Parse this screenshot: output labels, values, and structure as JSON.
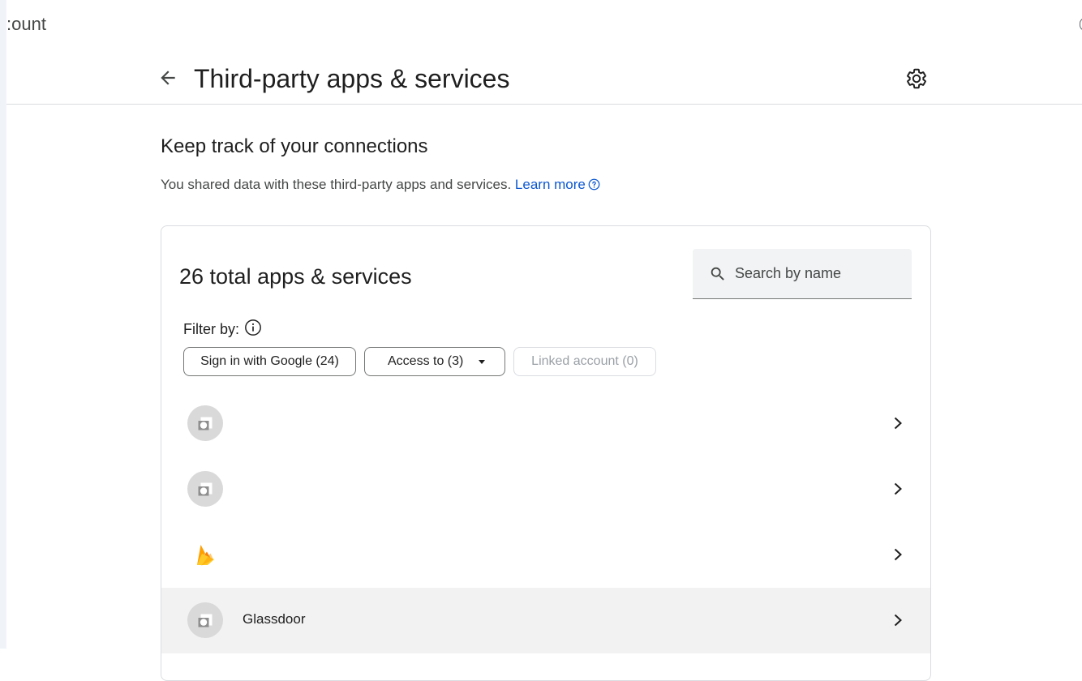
{
  "top": {
    "partial_label": ":ount"
  },
  "header": {
    "title": "Third-party apps & services"
  },
  "section": {
    "title": "Keep track of your connections",
    "description": "You shared data with these third-party apps and services.",
    "learn_more": "Learn more"
  },
  "card": {
    "title": "26 total apps & services",
    "search": {
      "placeholder": "Search by name",
      "value": ""
    },
    "filter_label": "Filter by:",
    "chips": {
      "signin": "Sign in with Google (24)",
      "access": "Access to (3)",
      "linked": "Linked account (0)"
    },
    "items": [
      {
        "name": "",
        "icon": "generic-app-icon"
      },
      {
        "name": "",
        "icon": "generic-app-icon"
      },
      {
        "name": "",
        "icon": "firebase-icon"
      },
      {
        "name": "Glassdoor",
        "icon": "generic-app-icon"
      }
    ]
  },
  "colors": {
    "link": "#0b57d0",
    "divider": "#dadce0",
    "hover_row": "#f2f2f2",
    "firebase_orange": "#f6820c",
    "firebase_yellow": "#ffca28"
  }
}
